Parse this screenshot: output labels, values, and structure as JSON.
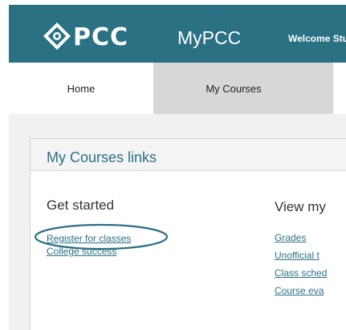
{
  "header": {
    "logo_text": "PCC",
    "app_name": "MyPCC",
    "welcome_text": "Welcome Student",
    "background_color": "#2a7184"
  },
  "tabs": [
    {
      "label": "Home",
      "active": true
    },
    {
      "label": "My Courses",
      "active": false
    }
  ],
  "card": {
    "title": "My Courses links",
    "columns": [
      {
        "heading": "Get started",
        "links": [
          "Register for classes",
          "College success"
        ]
      },
      {
        "heading": "View my",
        "links": [
          "Grades",
          "Unofficial t",
          "Class sched",
          "Course eva"
        ]
      }
    ]
  },
  "colors": {
    "accent": "#2a7184",
    "tab_bar": "#d7d7d7",
    "content_bg": "#f1f1f1"
  },
  "icons": {
    "logo_mark": "pcc-diamond-logo-icon"
  }
}
